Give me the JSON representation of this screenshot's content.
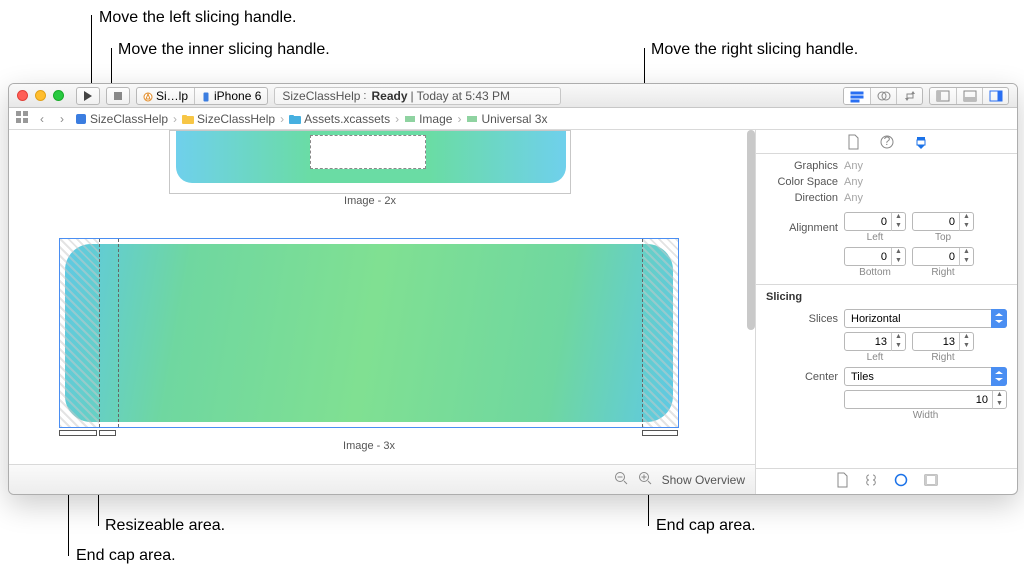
{
  "callouts": {
    "left_handle": "Move the left slicing handle.",
    "inner_handle": "Move the inner slicing handle.",
    "right_handle": "Move the right slicing handle.",
    "resizeable": "Resizeable area.",
    "end_cap_left": "End cap area.",
    "end_cap_right": "End cap area."
  },
  "toolbar": {
    "scheme_app": "Si…lp",
    "scheme_device": "iPhone 6",
    "status_project": "SizeClassHelp",
    "status_state": "Ready",
    "status_sep": " | ",
    "status_time": "Today at 5:43 PM"
  },
  "jump": {
    "c1": "SizeClassHelp",
    "c2": "SizeClassHelp",
    "c3": "Assets.xcassets",
    "c4": "Image",
    "c5": "Universal 3x"
  },
  "canvas": {
    "img2_label": "Image - 2x",
    "img3_label": "Image - 3x",
    "zoom_out": "−",
    "zoom_in": "+",
    "show_overview": "Show Overview"
  },
  "inspector": {
    "graphics_k": "Graphics",
    "graphics_v": "Any",
    "colorspace_k": "Color Space",
    "colorspace_v": "Any",
    "direction_k": "Direction",
    "direction_v": "Any",
    "alignment_k": "Alignment",
    "align_left_v": "0",
    "align_left_cap": "Left",
    "align_top_v": "0",
    "align_top_cap": "Top",
    "align_bottom_v": "0",
    "align_bottom_cap": "Bottom",
    "align_right_v": "0",
    "align_right_cap": "Right",
    "slicing_head": "Slicing",
    "slices_k": "Slices",
    "slices_v": "Horizontal",
    "slice_left_v": "13",
    "slice_left_cap": "Left",
    "slice_right_v": "13",
    "slice_right_cap": "Right",
    "center_k": "Center",
    "center_v": "Tiles",
    "width_v": "10",
    "width_cap": "Width"
  }
}
